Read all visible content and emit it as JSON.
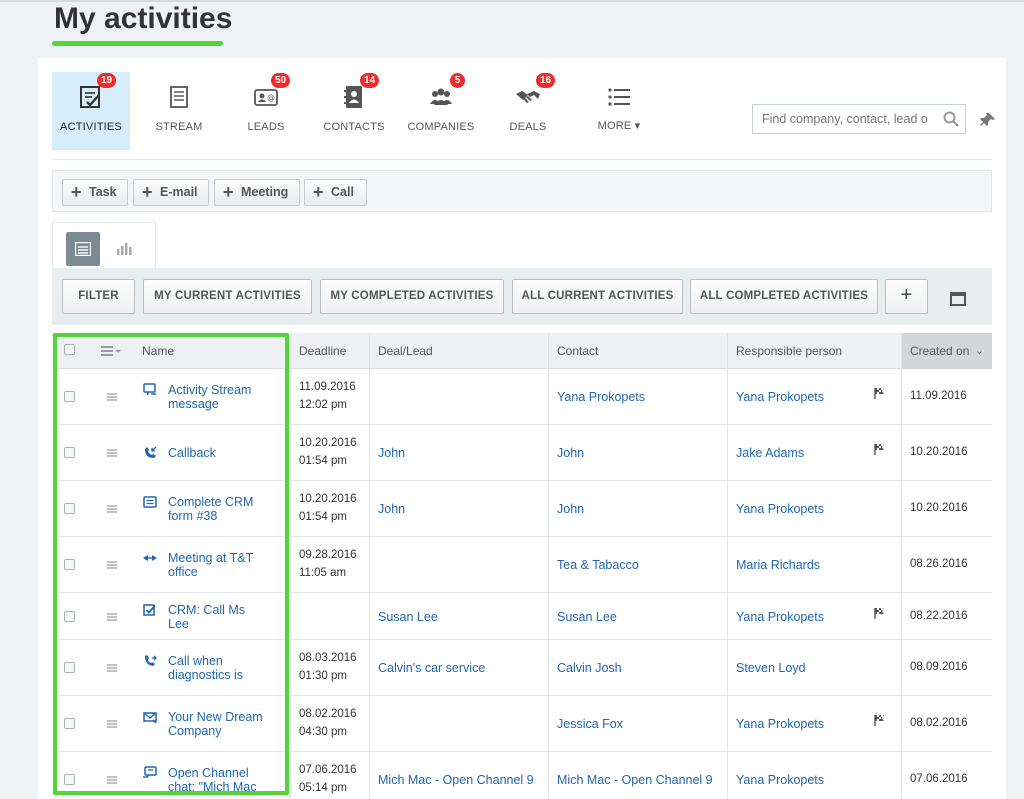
{
  "page": {
    "title": "My activities"
  },
  "nav": {
    "items": [
      {
        "label": "ACTIVITIES",
        "badge": "19",
        "icon": "activities-checklist-icon",
        "active": true
      },
      {
        "label": "STREAM",
        "badge": "",
        "icon": "stream-document-icon"
      },
      {
        "label": "LEADS",
        "badge": "50",
        "icon": "leads-card-icon"
      },
      {
        "label": "CONTACTS",
        "badge": "14",
        "icon": "contacts-book-icon"
      },
      {
        "label": "COMPANIES",
        "badge": "5",
        "icon": "companies-people-icon"
      },
      {
        "label": "DEALS",
        "badge": "16",
        "icon": "deals-handshake-icon"
      },
      {
        "label": "MORE",
        "badge": "",
        "icon": "more-list-icon"
      }
    ],
    "more_arrow": "▾"
  },
  "search": {
    "placeholder": "Find company, contact, lead o"
  },
  "quick_add": {
    "task": "Task",
    "email": "E-mail",
    "meeting": "Meeting",
    "call": "Call",
    "plus": "+"
  },
  "filters": {
    "filter": "FILTER",
    "my_current": "MY CURRENT ACTIVITIES",
    "my_completed": "MY COMPLETED ACTIVITIES",
    "all_current": "ALL CURRENT ACTIVITIES",
    "all_completed": "ALL COMPLETED ACTIVITIES",
    "add": "+"
  },
  "table": {
    "headers": {
      "name": "Name",
      "deadline": "Deadline",
      "deal": "Deal/Lead",
      "contact": "Contact",
      "responsible": "Responsible person",
      "created": "Created on"
    },
    "rows": [
      {
        "icon": "stream-message-icon",
        "name1": "Activity Stream",
        "name2": "message",
        "date": "11.09.2016",
        "time": "12:02 pm",
        "deal": "",
        "contact": "Yana Prokopets",
        "responsible": "Yana Prokopets",
        "flag": true,
        "created": "11.09.2016"
      },
      {
        "icon": "callback-phone-icon",
        "name1": "Callback",
        "name2": "",
        "date": "10.20.2016",
        "time": "01:54 pm",
        "deal": "John",
        "contact": "John",
        "responsible": "Jake Adams",
        "flag": true,
        "created": "10.20.2016"
      },
      {
        "icon": "crm-form-icon",
        "name1": "Complete CRM",
        "name2": "form #38",
        "date": "10.20.2016",
        "time": "01:54 pm",
        "deal": "John",
        "contact": "John",
        "responsible": "Yana Prokopets",
        "flag": false,
        "created": "10.20.2016"
      },
      {
        "icon": "meeting-arrows-icon",
        "name1": "Meeting at T&T",
        "name2": "office",
        "date": "09.28.2016",
        "time": "11:05 am",
        "deal": "",
        "contact": "Tea & Tabacco",
        "responsible": "Maria Richards",
        "flag": false,
        "created": "08.26.2016"
      },
      {
        "icon": "task-check-icon",
        "name1": "CRM: Call Ms",
        "name2": "Lee",
        "date": "",
        "time": "",
        "deal": "Susan Lee",
        "contact": "Susan Lee",
        "responsible": "Yana Prokopets",
        "flag": true,
        "created": "08.22.2016"
      },
      {
        "icon": "outgoing-call-icon",
        "name1": "Call when",
        "name2": "diagnostics is",
        "date": "08.03.2016",
        "time": "01:30 pm",
        "deal": "Calvin's car service",
        "contact": "Calvin Josh",
        "responsible": "Steven Loyd",
        "flag": false,
        "created": "08.09.2016"
      },
      {
        "icon": "email-icon",
        "name1": "Your New Dream",
        "name2": "Company",
        "date": "08.02.2016",
        "time": "04:30 pm",
        "deal": "",
        "contact": "Jessica Fox",
        "responsible": "Yana Prokopets",
        "flag": true,
        "created": "08.02.2016"
      },
      {
        "icon": "open-channel-chat-icon",
        "name1": "Open Channel",
        "name2": "chat: \"Mich Mac",
        "date": "07.06.2016",
        "time": "05:14 pm",
        "deal": "Mich Mac - Open Channel 9",
        "contact": "Mich Mac - Open Channel 9",
        "responsible": "Yana Prokopets",
        "flag": false,
        "created": "07.06.2016"
      }
    ]
  },
  "colors": {
    "accent_link": "#2067b0",
    "badge": "#f02b2b",
    "highlight": "#55d43a",
    "active_tab": "#d6eefa"
  }
}
